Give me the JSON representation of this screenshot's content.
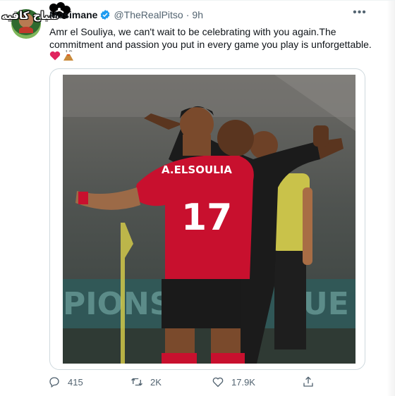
{
  "watermark": {
    "text": "صباح كافيه"
  },
  "author": {
    "display_name": "Mosimane",
    "handle": "@TheRealPitso",
    "separator": "·",
    "time": "9h"
  },
  "tweet": {
    "text": "Amr el Souliya, we can't wait to be celebrating with you again.The commitment and passion you put in every game you play is unforgettable.",
    "emojis": [
      "heart-emoji",
      "volcano-emoji"
    ]
  },
  "media": {
    "shirt_name": "A.ELSOULIA",
    "shirt_number": "17",
    "banner_text": "PIONS",
    "banner_text_right": "UE"
  },
  "actions": {
    "replies": "415",
    "retweets": "2K",
    "likes": "17.9K"
  },
  "colors": {
    "text_primary": "#0f1419",
    "text_secondary": "#536471",
    "verified": "#1d9bf0",
    "heart": "#e0245e",
    "border": "#cfd9de"
  }
}
